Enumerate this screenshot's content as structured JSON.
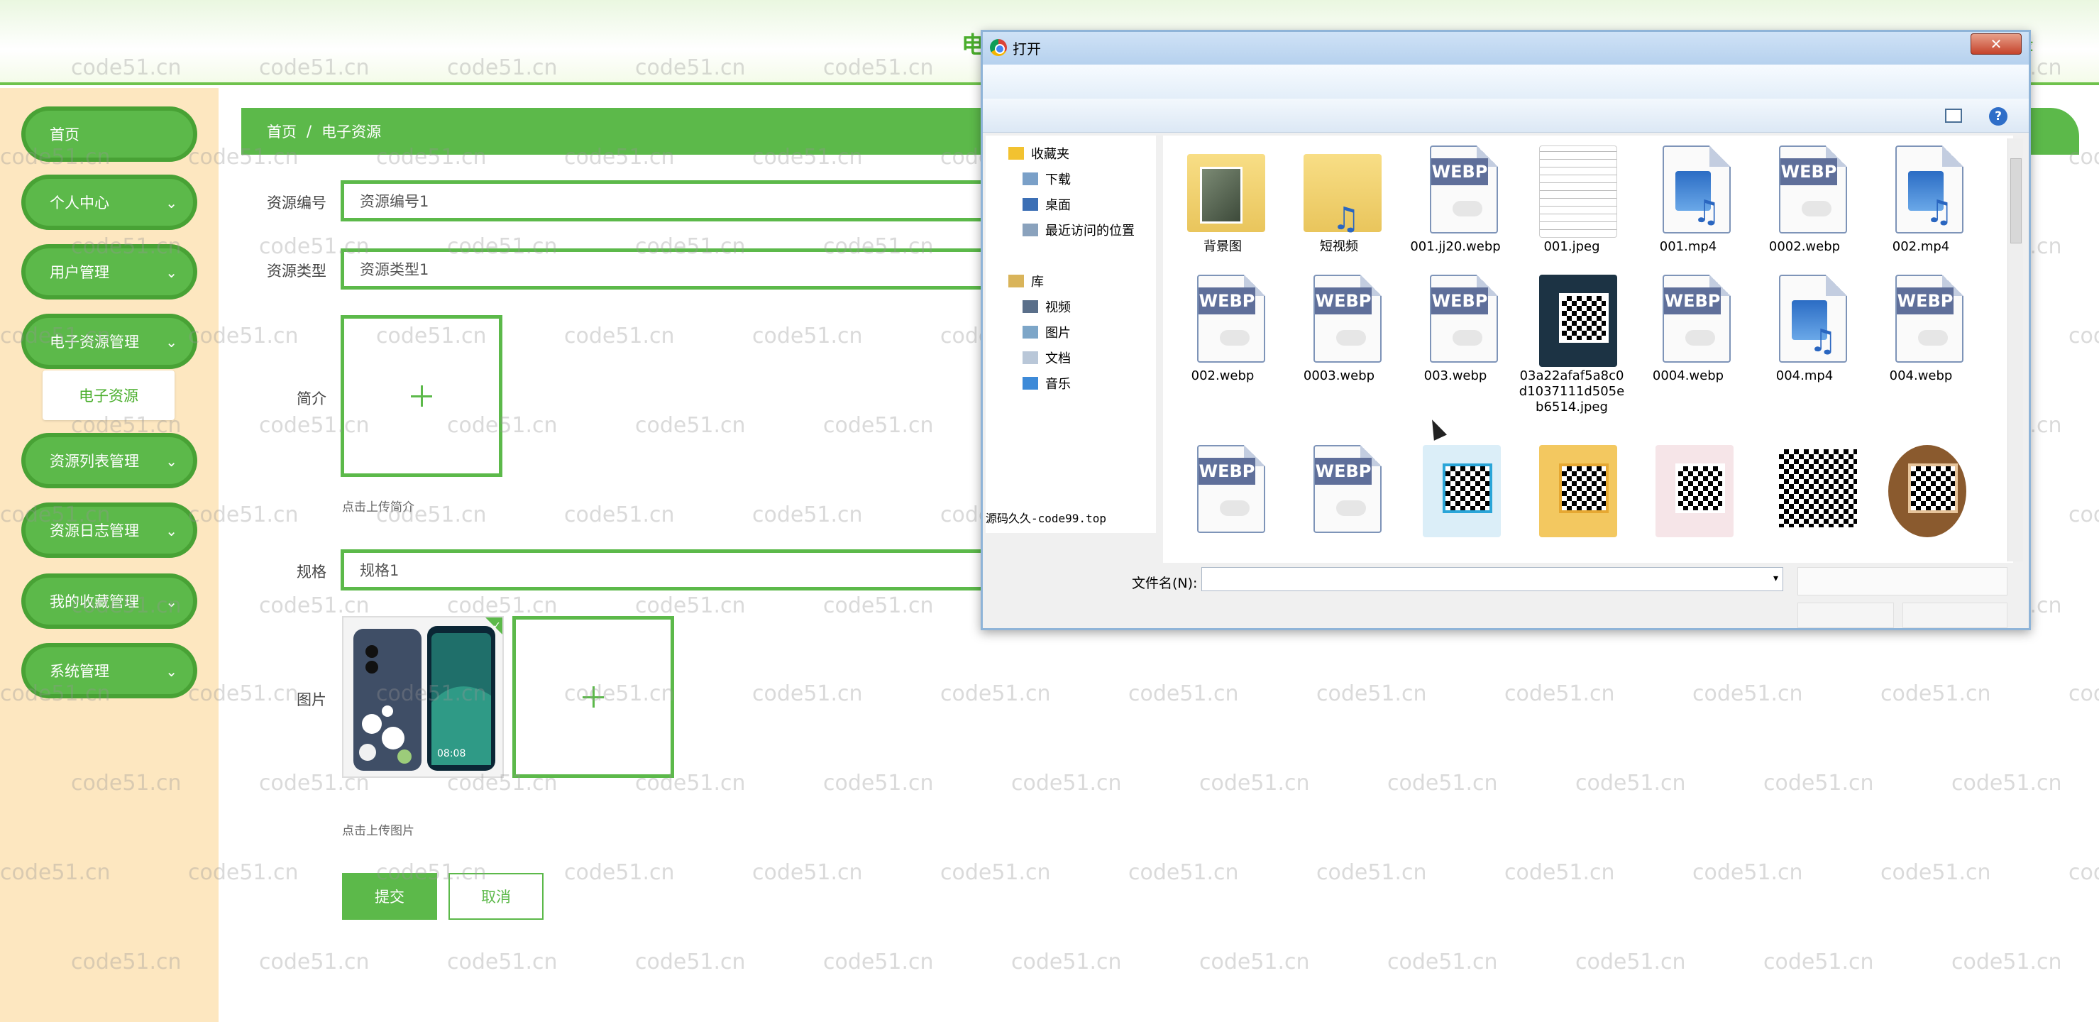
{
  "header": {
    "title": "电",
    "logout": "录"
  },
  "sidebar": {
    "items": [
      {
        "label": "首页",
        "chevron": ""
      },
      {
        "label": "个人中心",
        "chevron": "⌄"
      },
      {
        "label": "用户管理",
        "chevron": "⌄"
      },
      {
        "label": "电子资源管理",
        "chevron": "⌄"
      },
      {
        "label": "资源列表管理",
        "chevron": "⌄"
      },
      {
        "label": "资源日志管理",
        "chevron": "⌄"
      },
      {
        "label": "我的收藏管理",
        "chevron": "⌄"
      },
      {
        "label": "系统管理",
        "chevron": "⌄"
      }
    ],
    "submenu_active": "电子资源"
  },
  "breadcrumb": {
    "home": "首页",
    "separator": "/",
    "current": "电子资源"
  },
  "form": {
    "code_label": "资源编号",
    "code_value": "资源编号1",
    "type_label": "资源类型",
    "type_value": "资源类型1",
    "intro_label": "简介",
    "intro_hint": "点击上传简介",
    "spec_label": "规格",
    "spec_value": "规格1",
    "image_label": "图片",
    "image_hint": "点击上传图片",
    "submit": "提交",
    "cancel": "取消"
  },
  "watermark": "code51.cn",
  "dialog": {
    "title": "打开",
    "close": "✕",
    "help": "?",
    "nav": [
      {
        "label": "收藏夹",
        "icon": "star-icon"
      },
      {
        "label": "下载",
        "icon": "download-folder-icon"
      },
      {
        "label": "桌面",
        "icon": "desktop-icon"
      },
      {
        "label": "最近访问的位置",
        "icon": "recent-places-icon"
      },
      {
        "label": "库",
        "icon": "library-icon"
      },
      {
        "label": "视频",
        "icon": "video-library-icon"
      },
      {
        "label": "图片",
        "icon": "picture-library-icon"
      },
      {
        "label": "文档",
        "icon": "document-library-icon"
      },
      {
        "label": "音乐",
        "icon": "music-library-icon"
      }
    ],
    "files": [
      {
        "name": "背景图",
        "kind": "folder-photo"
      },
      {
        "name": "短视频",
        "kind": "folder-video"
      },
      {
        "name": "001.jj20.webp",
        "kind": "webp"
      },
      {
        "name": "001.jpeg",
        "kind": "sheet"
      },
      {
        "name": "001.mp4",
        "kind": "video"
      },
      {
        "name": "0002.webp",
        "kind": "webp"
      },
      {
        "name": "002.mp4",
        "kind": "video"
      },
      {
        "name": "002.webp",
        "kind": "webp"
      },
      {
        "name": "0003.webp",
        "kind": "webp"
      },
      {
        "name": "003.webp",
        "kind": "webp"
      },
      {
        "name": "03a22afaf5a8c0d1037111d505eb6514.jpeg",
        "kind": "qr-dark"
      },
      {
        "name": "0004.webp",
        "kind": "webp"
      },
      {
        "name": "004.mp4",
        "kind": "video"
      },
      {
        "name": "004.webp",
        "kind": "webp"
      },
      {
        "name": "",
        "kind": "webp"
      },
      {
        "name": "",
        "kind": "webp"
      },
      {
        "name": "",
        "kind": "qr-blue"
      },
      {
        "name": "",
        "kind": "qr-poster"
      },
      {
        "name": "",
        "kind": "qr-pink"
      },
      {
        "name": "",
        "kind": "qr-plain"
      },
      {
        "name": "",
        "kind": "qr-brown"
      }
    ],
    "webp_tag": "WEBP",
    "source_note": "源码久久-code99.top",
    "filename_label": "文件名(N):",
    "filename_value": "",
    "dropdown_arrow": "▾"
  }
}
